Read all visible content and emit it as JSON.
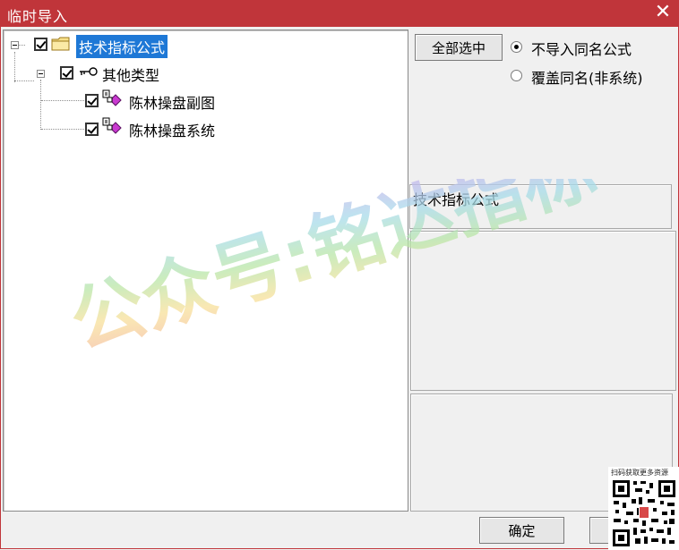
{
  "window": {
    "title": "临时导入",
    "close_icon": "close-icon"
  },
  "tree": {
    "root": {
      "label": "技术指标公式",
      "checked": true,
      "icon": "folder-icon"
    },
    "group": {
      "label": "其他类型",
      "checked": true,
      "icon": "key-icon"
    },
    "items": [
      {
        "label": "陈林操盘副图",
        "checked": true,
        "icon": "formula-icon"
      },
      {
        "label": "陈林操盘系统",
        "checked": true,
        "icon": "formula-icon"
      }
    ]
  },
  "options": {
    "select_all_label": "全部选中",
    "radio_skip_label": "不导入同名公式",
    "radio_overwrite_label": "覆盖同名(非系统)",
    "selected": "skip"
  },
  "info": {
    "category_text": "技术指标公式"
  },
  "footer": {
    "ok_label": "确定"
  },
  "watermark": {
    "text": "公众号:铭达指标"
  },
  "qr": {
    "caption": "扫码获取更多资源"
  },
  "colors": {
    "titlebar": "#c0353a",
    "selection": "#1e78d6",
    "window_bg": "#f0f0f0",
    "tree_bg": "#ffffff"
  }
}
